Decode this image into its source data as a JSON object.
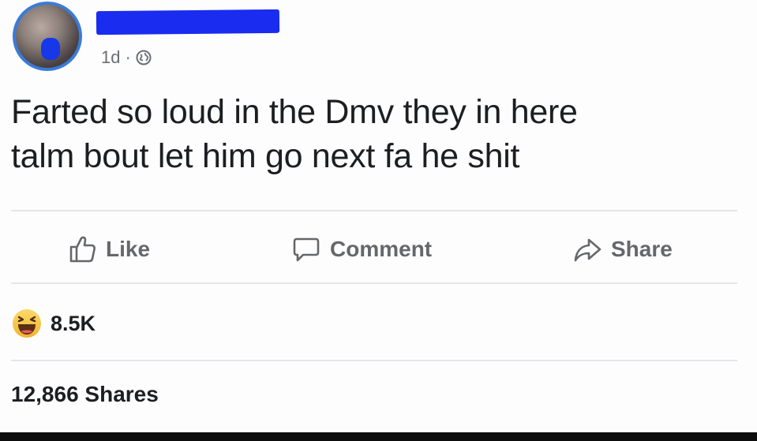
{
  "post": {
    "time": "1d",
    "separator": "·",
    "privacy_icon": "globe-icon",
    "text_line1": "Farted so loud in the Dmv they in here",
    "text_line2": "talm bout let him go next fa he shit"
  },
  "actions": {
    "like_label": "Like",
    "comment_label": "Comment",
    "share_label": "Share"
  },
  "reactions": {
    "icon": "haha-emoji-icon",
    "count": "8.5K"
  },
  "shares": {
    "label": "12,866 Shares"
  },
  "colors": {
    "avatar_ring": "#3b7bd8",
    "redaction": "#1a2cf0",
    "muted_text": "#65676b",
    "haha_yellow": "#f7c93f"
  }
}
